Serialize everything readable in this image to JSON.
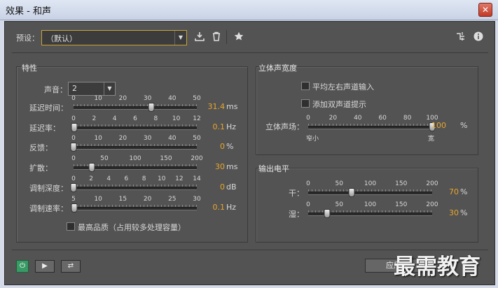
{
  "window": {
    "title": "效果 - 和声",
    "close": "✕"
  },
  "toolbar": {
    "preset_label": "预设：",
    "preset_value": "（默认）"
  },
  "characteristics": {
    "title": "特性",
    "voices_label": "声音：",
    "voices_value": "2",
    "sliders": [
      {
        "label": "延迟时间：",
        "ticks": [
          "0",
          "10",
          "20",
          "30",
          "40",
          "50"
        ],
        "min": 0,
        "max": 50,
        "value": 31.4,
        "display": "31.4",
        "unit": "ms"
      },
      {
        "label": "延迟率：",
        "ticks": [
          "0",
          "2",
          "4",
          "6",
          "8",
          "10",
          "12"
        ],
        "min": 0,
        "max": 12,
        "value": 0.1,
        "display": "0.1",
        "unit": "Hz"
      },
      {
        "label": "反馈：",
        "ticks": [
          "0",
          "10",
          "20",
          "30",
          "40",
          "50"
        ],
        "min": 0,
        "max": 50,
        "value": 0,
        "display": "0",
        "unit": "%"
      },
      {
        "label": "扩散：",
        "ticks": [
          "0",
          "50",
          "100",
          "150",
          "200"
        ],
        "min": 0,
        "max": 200,
        "value": 30,
        "display": "30",
        "unit": "ms"
      },
      {
        "label": "调制深度：",
        "ticks": [
          "0",
          "2",
          "4",
          "6",
          "8",
          "10",
          "12",
          "14"
        ],
        "min": 0,
        "max": 15,
        "value": 0,
        "display": "0",
        "unit": "dB"
      },
      {
        "label": "调制速率：",
        "ticks": [
          "5",
          "10",
          "15",
          "20",
          "25",
          "30"
        ],
        "min": 0,
        "max": 30,
        "value": 0.1,
        "display": "0.1",
        "unit": "Hz"
      }
    ],
    "highest_quality": "最高品质（占用较多处理容量）"
  },
  "stereo": {
    "title": "立体声宽度",
    "avg_lr": "平均左右声道输入",
    "binaural": "添加双声道提示",
    "field_label": "立体声场：",
    "field_ticks": [
      "0",
      "20",
      "40",
      "60",
      "80",
      "100"
    ],
    "field_value": 100,
    "field_display": "100",
    "field_unit": "%",
    "narrow": "窄小",
    "wide": "宽"
  },
  "output": {
    "title": "输出电平",
    "sliders": [
      {
        "label": "干：",
        "ticks": [
          "0",
          "50",
          "100",
          "150",
          "200"
        ],
        "min": 0,
        "max": 200,
        "value": 70,
        "display": "70",
        "unit": "%"
      },
      {
        "label": "湿：",
        "ticks": [
          "0",
          "50",
          "100",
          "150",
          "200"
        ],
        "min": 0,
        "max": 200,
        "value": 30,
        "display": "30",
        "unit": "%"
      }
    ]
  },
  "bottom": {
    "power": "⏻",
    "play": "▶",
    "loop": "⇄",
    "apply": "应用"
  },
  "watermark": "最需教育",
  "colors": {
    "accent": "#e8a62c",
    "panel": "#535353",
    "power": "#3a9a66"
  },
  "icons": [
    "download-icon",
    "trash-icon",
    "star-icon",
    "routing-icon",
    "info-icon"
  ]
}
